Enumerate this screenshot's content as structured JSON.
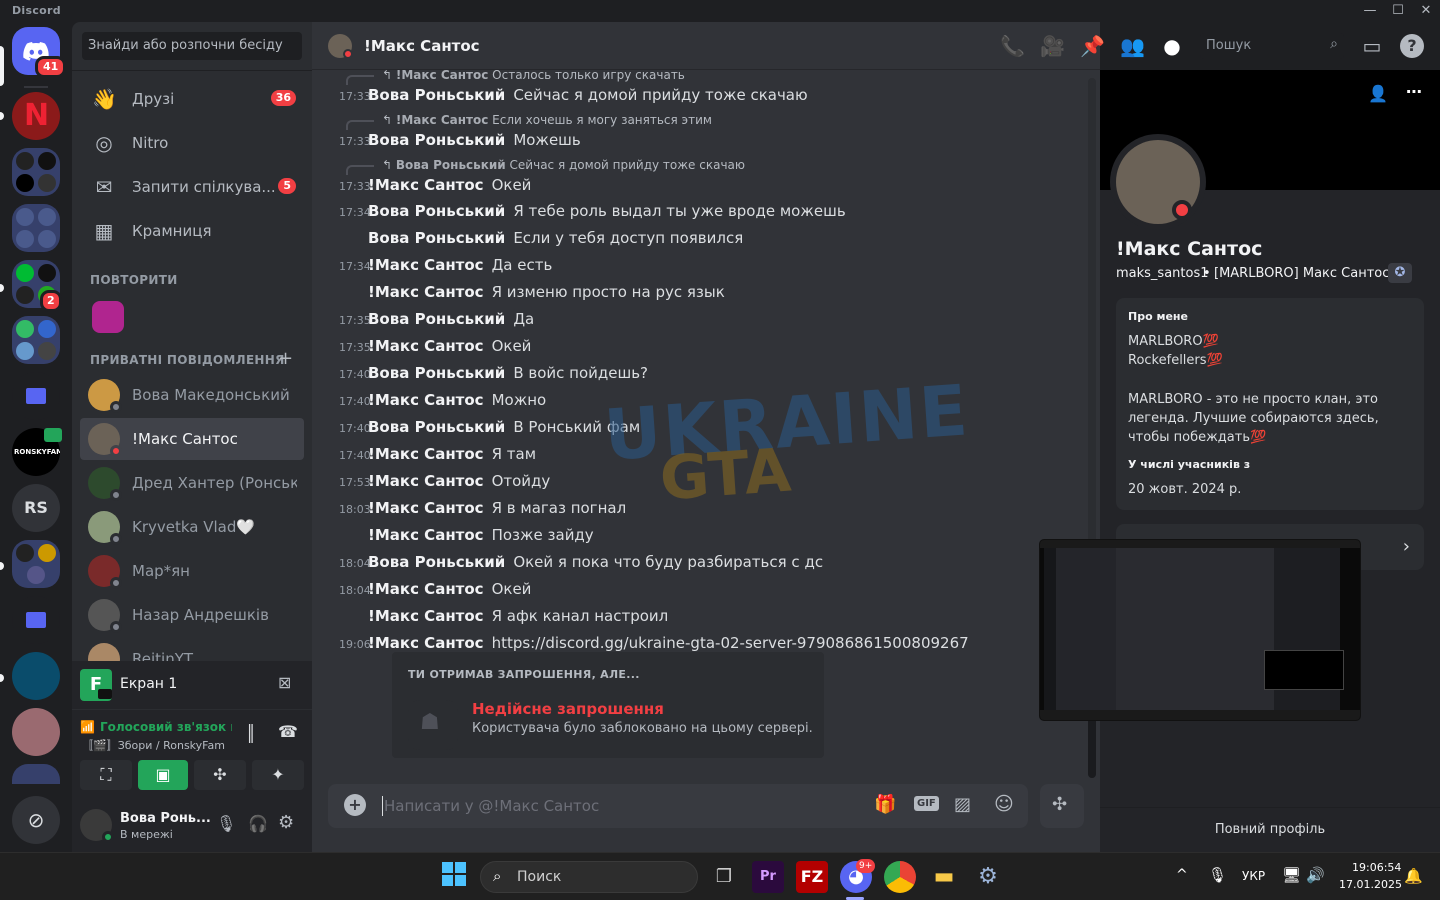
{
  "window": {
    "app_name": "Discord"
  },
  "rail": {
    "home_badge": "41",
    "server_badges": [
      "2"
    ],
    "ronsky_label": "RONSKYFAM",
    "rs_label": "RS"
  },
  "sidebar": {
    "search_placeholder": "Знайди або розпочни бесіду",
    "nav": [
      {
        "label": "Друзі",
        "badge": "36",
        "icon": "friends-icon"
      },
      {
        "label": "Nitro",
        "badge": "",
        "icon": "nitro-icon"
      },
      {
        "label": "Запити спілкува...",
        "badge": "5",
        "icon": "message-requests-icon"
      },
      {
        "label": "Крамниця",
        "badge": "",
        "icon": "shop-icon"
      }
    ],
    "repeat_section": "ПОВТОРИТИ",
    "dm_section": "ПРИВАТНІ ПОВІДОМЛЕННЯ",
    "dms": [
      {
        "name": "Вова Македонський",
        "status": "offline"
      },
      {
        "name": "!Макс Сантос",
        "status": "dnd"
      },
      {
        "name": "Дред Хантер (Ронськ...",
        "status": "offline"
      },
      {
        "name": "Kryvetka Vlad🤍",
        "status": "offline"
      },
      {
        "name": "Мар*ян",
        "status": "offline"
      },
      {
        "name": "Назар Андрешків",
        "status": "offline"
      },
      {
        "name": "ReitinYT",
        "status": "offline"
      }
    ],
    "screen_share": {
      "label": "Екран 1",
      "initial": "F"
    },
    "voice": {
      "status": "Голосовий зв'язок пі",
      "channel": "〚🎬〛Збори / RonskyFam"
    },
    "user": {
      "name": "Вова Ронь...",
      "status": "В мережі"
    }
  },
  "chat": {
    "header_name": "!Макс Сантос",
    "search_placeholder": "Пошук",
    "messages": [
      {
        "type": "reply",
        "reply_author": "!Макс Сантос",
        "reply_text": "Осталось только игру скачать"
      },
      {
        "type": "msg",
        "time": "17:33",
        "author": "Вова Роньський",
        "text": "Сейчас я домой прийду тоже скачаю"
      },
      {
        "type": "reply",
        "reply_author": "!Макс Сантос",
        "reply_text": "Если хочешь я могу заняться этим"
      },
      {
        "type": "msg",
        "time": "17:33",
        "author": "Вова Роньський",
        "text": "Можешь"
      },
      {
        "type": "reply",
        "reply_author": "Вова Роньський",
        "reply_text": "Сейчас я домой прийду тоже скачаю"
      },
      {
        "type": "msg",
        "time": "17:33",
        "author": "!Макс Сантос",
        "text": "Окей"
      },
      {
        "type": "msg",
        "time": "17:34",
        "author": "Вова Роньський",
        "text": "Я тебе роль выдал ты уже вроде можешь"
      },
      {
        "type": "msg",
        "time": "",
        "author": "Вова Роньський",
        "text": "Если у тебя доступ появился"
      },
      {
        "type": "msg",
        "time": "17:34",
        "author": "!Макс Сантос",
        "text": "Да есть"
      },
      {
        "type": "msg",
        "time": "",
        "author": "!Макс Сантос",
        "text": "Я изменю просто на рус язык"
      },
      {
        "type": "msg",
        "time": "17:35",
        "author": "Вова Роньський",
        "text": "Да"
      },
      {
        "type": "msg",
        "time": "17:35",
        "author": "!Макс Сантос",
        "text": "Окей"
      },
      {
        "type": "msg",
        "time": "17:40",
        "author": "Вова Роньський",
        "text": "В войс пойдешь?"
      },
      {
        "type": "msg",
        "time": "17:40",
        "author": "!Макс Сантос",
        "text": "Можно"
      },
      {
        "type": "msg",
        "time": "17:40",
        "author": "Вова Роньський",
        "text": "В Ронський фам"
      },
      {
        "type": "msg",
        "time": "17:40",
        "author": "!Макс Сантос",
        "text": "Я там"
      },
      {
        "type": "msg",
        "time": "17:53",
        "author": "!Макс Сантос",
        "text": "Отойду"
      },
      {
        "type": "msg",
        "time": "18:03",
        "author": "!Макс Сантос",
        "text": "Я в магаз погнал"
      },
      {
        "type": "msg",
        "time": "",
        "author": "!Макс Сантос",
        "text": "Позже зайду"
      },
      {
        "type": "msg",
        "time": "18:04",
        "author": "Вова Роньський",
        "text": "Окей я пока что буду разбираться с дс"
      },
      {
        "type": "msg",
        "time": "18:04",
        "author": "!Макс Сантос",
        "text": "Окей"
      },
      {
        "type": "msg",
        "time": "",
        "author": "!Макс Сантос",
        "text": "Я афк канал настроил"
      },
      {
        "type": "link",
        "time": "19:06",
        "author": "!Макс Сантос",
        "text": "https://discord.gg/ukraine-gta-02-server-979086861500809267"
      }
    ],
    "watermark_line1": "UKRAINE",
    "watermark_line2": "GTA",
    "invite": {
      "header": "ТИ ОТРИМАВ ЗАПРОШЕННЯ, АЛЕ...",
      "title": "Недійсне запрошення",
      "subtitle": "Користувача було заблоковано на цьому сервері."
    },
    "composer_placeholder": "Написати у @!Макс Сантос"
  },
  "profile": {
    "display_name": "!Макс Сантос",
    "username": "maks_santos1",
    "separator": "•",
    "clan_tag": "[MARLBORO] Макс Сантос",
    "about_title": "Про мене",
    "about_lines": [
      "MARLBORO💯",
      "Rockefellers💯",
      "",
      "MARLBORO - это не просто клан, это легенда. Лучшие собираются здесь, чтобы побеждать💯"
    ],
    "member_since_title": "У числі учасників з",
    "member_since": "20 жовт. 2024 р.",
    "full_profile": "Повний профіль"
  },
  "taskbar": {
    "search": "Поиск",
    "lang": "УКР",
    "time": "19:06:54",
    "date": "17.01.2025",
    "discord_badge": "9+"
  },
  "colors": {
    "accent": "#5865f2",
    "danger": "#f23f43",
    "online": "#23a55a",
    "link": "#00a8fc"
  }
}
